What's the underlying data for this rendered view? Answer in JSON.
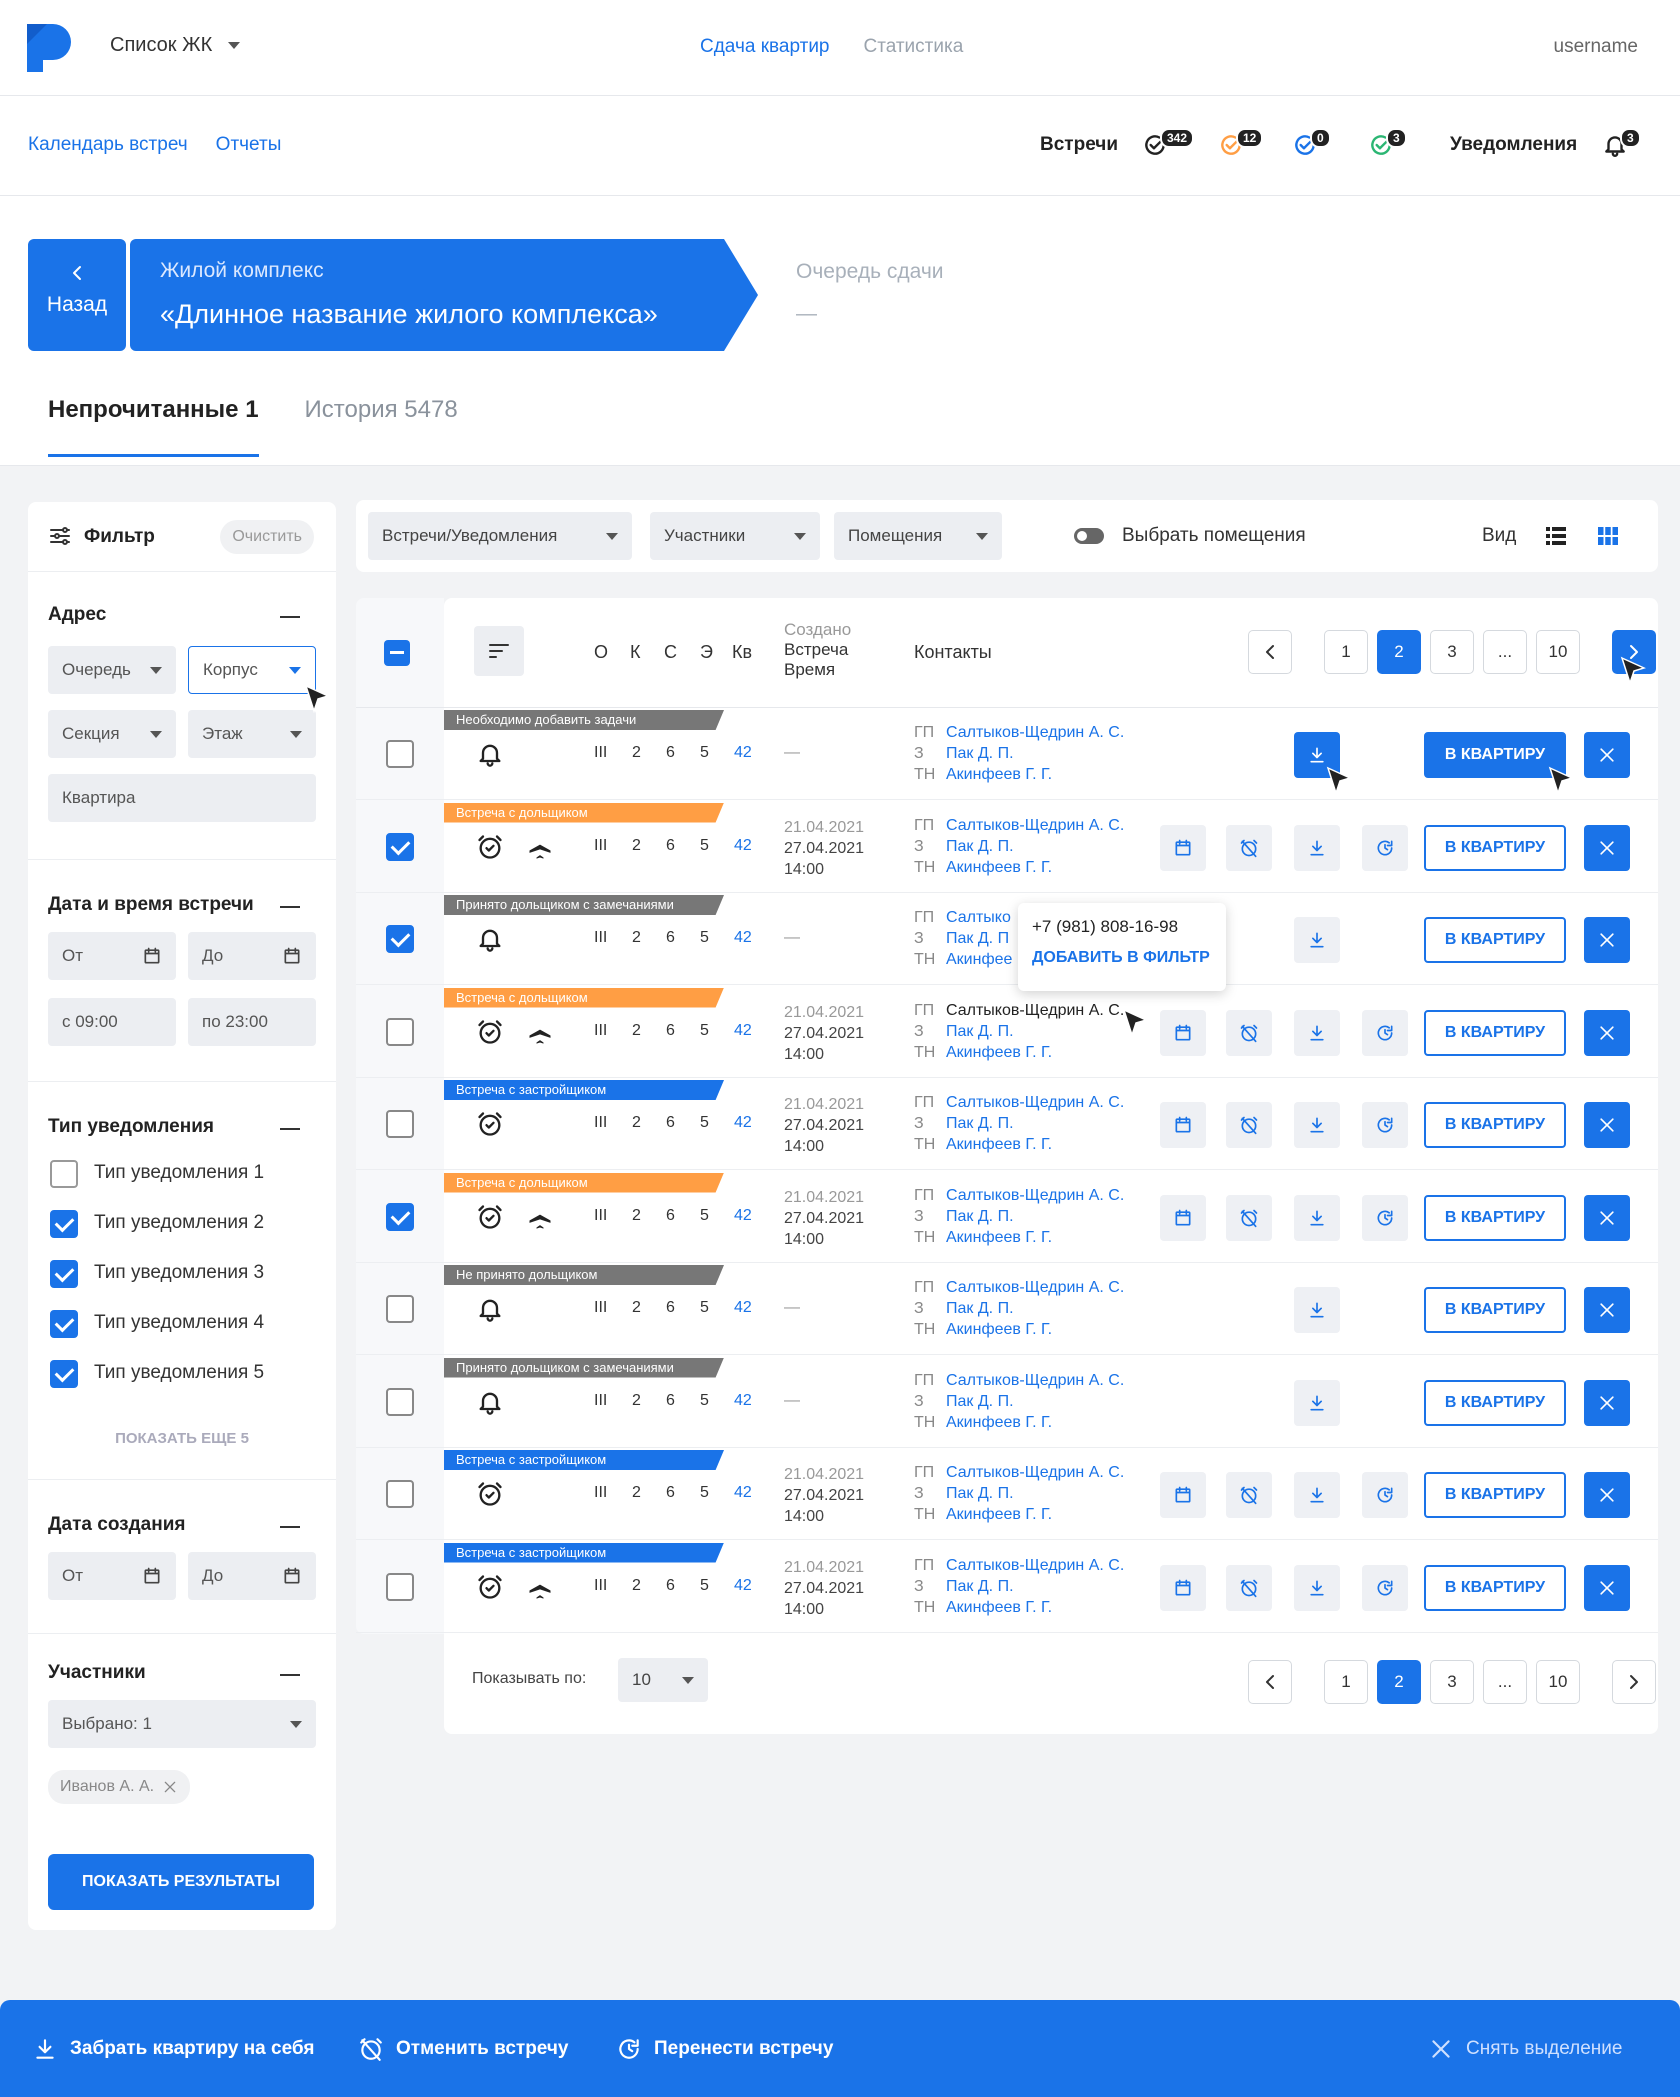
{
  "header": {
    "complex_select": "Список ЖК",
    "nav": [
      "Сдача квартир",
      "Статистика"
    ],
    "username": "username"
  },
  "subbar": {
    "links": [
      "Календарь встреч",
      "Отчеты"
    ],
    "meetings_label": "Встречи",
    "counters": [
      {
        "value": "342",
        "color": "#222222"
      },
      {
        "value": "12",
        "color": "#ff9e44"
      },
      {
        "value": "0",
        "color": "#1a73e8"
      },
      {
        "value": "3",
        "color": "#2bb673"
      }
    ],
    "notifications_label": "Уведомления",
    "notifications_count": "3"
  },
  "breadcrumb": {
    "back_label": "Назад",
    "complex_label": "Жилой комплекс",
    "complex_name": "«Длинное название жилого комплекса»",
    "queue_label": "Очередь сдачи",
    "queue_value": "—"
  },
  "tabs": [
    {
      "label": "Непрочитанные 1",
      "active": true
    },
    {
      "label": "История 5478",
      "active": false
    }
  ],
  "filter": {
    "title": "Фильтр",
    "clear": "Очистить",
    "address": {
      "title": "Адрес",
      "queue": "Очередь",
      "building": "Корпус",
      "section": "Секция",
      "floor": "Этаж",
      "apartment": "Квартира"
    },
    "meeting_dt": {
      "title": "Дата и время встречи",
      "from": "От",
      "to": "До",
      "time_from": "с 09:00",
      "time_to": "по 23:00"
    },
    "notif_type": {
      "title": "Тип уведомления",
      "items": [
        {
          "label": "Тип уведомления 1",
          "checked": false
        },
        {
          "label": "Тип уведомления 2",
          "checked": true
        },
        {
          "label": "Тип уведомления 3",
          "checked": true
        },
        {
          "label": "Тип уведомления 4",
          "checked": true
        },
        {
          "label": "Тип уведомления 5",
          "checked": true
        }
      ],
      "show_more": "ПОКАЗАТЬ ЕЩЕ 5"
    },
    "created": {
      "title": "Дата создания",
      "from": "От",
      "to": "До"
    },
    "participants": {
      "title": "Участники",
      "selected": "Выбрано: 1",
      "chip": "Иванов А. А."
    },
    "apply": "ПОКАЗАТЬ РЕЗУЛЬТАТЫ"
  },
  "toolbar": {
    "selects": [
      "Встречи/Уведомления",
      "Участники",
      "Помещения"
    ],
    "toggle_label": "Выбрать помещения",
    "view_label": "Вид"
  },
  "table": {
    "headers": {
      "o": "О",
      "k": "К",
      "s": "С",
      "e": "Э",
      "kv": "Кв",
      "created": "Создано",
      "meeting": "Встреча",
      "time": "Время",
      "contacts": "Контакты"
    },
    "pages": [
      "1",
      "2",
      "3",
      "...",
      "10"
    ],
    "current_page": "2",
    "roles": [
      "ГП",
      "З",
      "ТН"
    ],
    "apt_button": "В КВАРТИРУ",
    "rows": [
      {
        "tag": "Необходимо добавить задачи",
        "tag_color": "gray",
        "checked": false,
        "icons": [
          "bell"
        ],
        "o": "III",
        "k": "2",
        "s": "6",
        "e": "5",
        "kv": "42",
        "created": "",
        "meeting": "",
        "time": "",
        "contacts": [
          "Салтыков-Щедрин А. С.",
          "Пак Д. П.",
          "Акинфеев Г. Г."
        ],
        "meeting_actions": false
      },
      {
        "tag": "Встреча с дольщиком",
        "tag_color": "orange",
        "checked": true,
        "icons": [
          "alarm",
          "plane"
        ],
        "o": "III",
        "k": "2",
        "s": "6",
        "e": "5",
        "kv": "42",
        "created": "21.04.2021",
        "meeting": "27.04.2021",
        "time": "14:00",
        "contacts": [
          "Салтыков-Щедрин А. С.",
          "Пак Д. П.",
          "Акинфеев Г. Г."
        ],
        "meeting_actions": true
      },
      {
        "tag": "Принято дольщиком с замечаниями",
        "tag_color": "gray",
        "checked": true,
        "icons": [
          "bell"
        ],
        "o": "III",
        "k": "2",
        "s": "6",
        "e": "5",
        "kv": "42",
        "created": "",
        "meeting": "",
        "time": "",
        "contacts": [
          "Салтыко",
          "Пак Д. П",
          "Акинфее"
        ],
        "meeting_actions": false
      },
      {
        "tag": "Встреча с дольщиком",
        "tag_color": "orange",
        "checked": false,
        "icons": [
          "alarm",
          "plane"
        ],
        "o": "III",
        "k": "2",
        "s": "6",
        "e": "5",
        "kv": "42",
        "created": "21.04.2021",
        "meeting": "27.04.2021",
        "time": "14:00",
        "contacts": [
          "Салтыков-Щедрин А. С.",
          "Пак Д. П.",
          "Акинфеев Г. Г."
        ],
        "meeting_actions": true
      },
      {
        "tag": "Встреча с застройщиком",
        "tag_color": "blue",
        "checked": false,
        "icons": [
          "alarm"
        ],
        "o": "III",
        "k": "2",
        "s": "6",
        "e": "5",
        "kv": "42",
        "created": "21.04.2021",
        "meeting": "27.04.2021",
        "time": "14:00",
        "contacts": [
          "Салтыков-Щедрин А. С.",
          "Пак Д. П.",
          "Акинфеев Г. Г."
        ],
        "meeting_actions": true
      },
      {
        "tag": "Встреча с дольщиком",
        "tag_color": "orange",
        "checked": true,
        "icons": [
          "alarm",
          "plane"
        ],
        "o": "III",
        "k": "2",
        "s": "6",
        "e": "5",
        "kv": "42",
        "created": "21.04.2021",
        "meeting": "27.04.2021",
        "time": "14:00",
        "contacts": [
          "Салтыков-Щедрин А. С.",
          "Пак Д. П.",
          "Акинфеев Г. Г."
        ],
        "meeting_actions": true
      },
      {
        "tag": "Не принято дольщиком",
        "tag_color": "gray",
        "checked": false,
        "icons": [
          "bell"
        ],
        "o": "III",
        "k": "2",
        "s": "6",
        "e": "5",
        "kv": "42",
        "created": "",
        "meeting": "",
        "time": "",
        "contacts": [
          "Салтыков-Щедрин А. С.",
          "Пак Д. П.",
          "Акинфеев Г. Г."
        ],
        "meeting_actions": false
      },
      {
        "tag": "Принято дольщиком с замечаниями",
        "tag_color": "gray",
        "checked": false,
        "icons": [
          "bell"
        ],
        "o": "III",
        "k": "2",
        "s": "6",
        "e": "5",
        "kv": "42",
        "created": "",
        "meeting": "",
        "time": "",
        "contacts": [
          "Салтыков-Щедрин А. С.",
          "Пак Д. П.",
          "Акинфеев Г. Г."
        ],
        "meeting_actions": false
      },
      {
        "tag": "Встреча с застройщиком",
        "tag_color": "blue",
        "checked": false,
        "icons": [
          "alarm"
        ],
        "o": "III",
        "k": "2",
        "s": "6",
        "e": "5",
        "kv": "42",
        "created": "21.04.2021",
        "meeting": "27.04.2021",
        "time": "14:00",
        "contacts": [
          "Салтыков-Щедрин А. С.",
          "Пак Д. П.",
          "Акинфеев Г. Г."
        ],
        "meeting_actions": true
      },
      {
        "tag": "Встреча с застройщиком",
        "tag_color": "blue",
        "checked": false,
        "icons": [
          "alarm",
          "plane"
        ],
        "o": "III",
        "k": "2",
        "s": "6",
        "e": "5",
        "kv": "42",
        "created": "21.04.2021",
        "meeting": "27.04.2021",
        "time": "14:00",
        "contacts": [
          "Салтыков-Щедрин А. С.",
          "Пак Д. П.",
          "Акинфеев Г. Г."
        ],
        "meeting_actions": true
      }
    ],
    "empty_dash": "—",
    "per_page_label": "Показывать по:",
    "per_page_value": "10"
  },
  "tooltip": {
    "phone": "+7 (981) 808-16-98",
    "action": "ДОБАВИТЬ В ФИЛЬТР"
  },
  "bottombar": {
    "take": "Забрать квартиру на себя",
    "cancel": "Отменить встречу",
    "reschedule": "Перенести встречу",
    "deselect": "Снять выделение"
  }
}
